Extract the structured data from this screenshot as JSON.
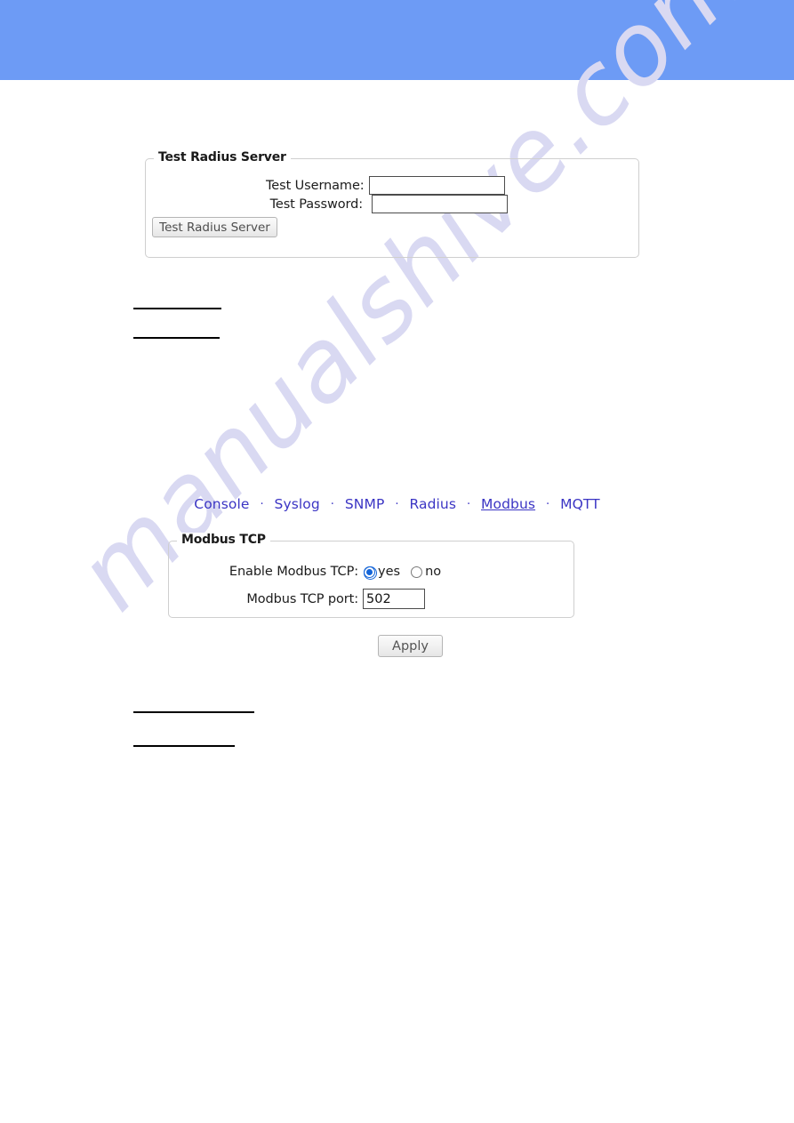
{
  "page": {
    "banner_color": "#6d9bf5",
    "background_color": "#ffffff",
    "watermark_text": "manualshive.com",
    "watermark_color": "#d9d9f2"
  },
  "test_radius_section": {
    "legend": "Test Radius Server",
    "username_label": "Test Username:",
    "username_value": "",
    "username_placeholder": "",
    "password_label": "Test Password:",
    "password_value": "",
    "password_placeholder": "",
    "button_label": "Test Radius Server"
  },
  "nav": {
    "separator": "·",
    "items": [
      {
        "label": "Console",
        "active": false
      },
      {
        "label": "Syslog",
        "active": false
      },
      {
        "label": "SNMP",
        "active": false
      },
      {
        "label": "Radius",
        "active": false
      },
      {
        "label": "Modbus",
        "active": true
      },
      {
        "label": "MQTT",
        "active": false
      }
    ],
    "link_color": "#3b35c4"
  },
  "modbus_section": {
    "legend": "Modbus TCP",
    "enable_label": "Enable Modbus TCP:",
    "enable_options": [
      {
        "label": "yes",
        "selected": true
      },
      {
        "label": "no",
        "selected": false
      }
    ],
    "port_label": "Modbus TCP port:",
    "port_value": "502",
    "port_placeholder": "",
    "apply_label": "Apply",
    "accent_color": "#1565d8"
  }
}
